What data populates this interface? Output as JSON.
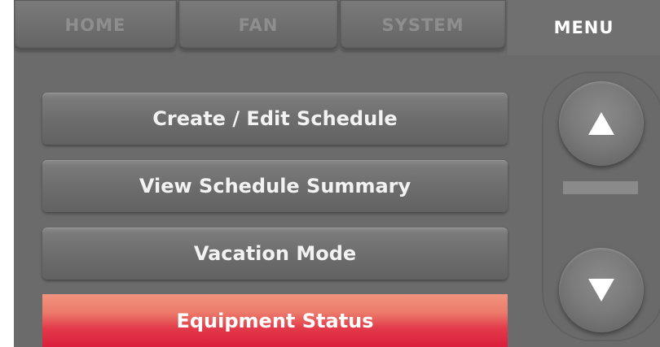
{
  "tabs": [
    {
      "label": "HOME"
    },
    {
      "label": "FAN"
    },
    {
      "label": "SYSTEM"
    },
    {
      "label": "MENU"
    }
  ],
  "active_tab": "MENU",
  "menu": {
    "items": [
      {
        "label": "Create / Edit Schedule"
      },
      {
        "label": "View Schedule Summary"
      },
      {
        "label": "Vacation Mode"
      },
      {
        "label": "Equipment Status"
      }
    ],
    "selected": "Equipment Status"
  },
  "scroll": {
    "up_icon": "up-arrow-icon",
    "down_icon": "down-arrow-icon"
  },
  "colors": {
    "screen_bg": "#6b6b6b",
    "selected_top": "#f0947e",
    "selected_bottom": "#dc1e3c",
    "active_tab_text": "#ffffff"
  }
}
